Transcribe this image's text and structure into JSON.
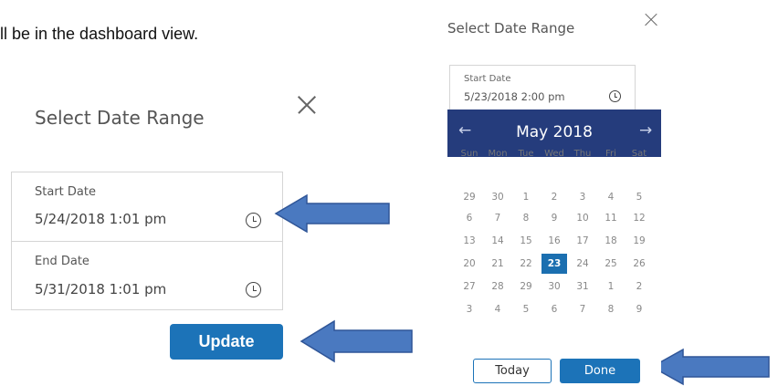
{
  "document": {
    "text_fragment": "ll be in the dashboard view."
  },
  "left_dialog": {
    "title": "Select Date Range",
    "close_icon": "close-icon",
    "start_date": {
      "label": "Start Date",
      "value": "5/24/2018 1:01 pm",
      "icon": "clock-icon"
    },
    "end_date": {
      "label": "End Date",
      "value": "5/31/2018 1:01 pm",
      "icon": "clock-icon"
    },
    "update_label": "Update"
  },
  "right_dialog": {
    "title": "Select Date Range",
    "close_icon": "close-icon",
    "start_date": {
      "label": "Start Date",
      "value": "5/23/2018 2:00 pm",
      "icon": "clock-icon"
    },
    "calendar": {
      "month_label": "May 2018",
      "prev_icon": "←",
      "next_icon": "→",
      "weekdays": [
        "Sun",
        "Mon",
        "Tue",
        "Wed",
        "Thu",
        "Fri",
        "Sat"
      ],
      "weeks": [
        [
          "29",
          "30",
          "1",
          "2",
          "3",
          "4",
          "5"
        ],
        [
          "6",
          "7",
          "8",
          "9",
          "10",
          "11",
          "12"
        ],
        [
          "13",
          "14",
          "15",
          "16",
          "17",
          "18",
          "19"
        ],
        [
          "20",
          "21",
          "22",
          "23",
          "24",
          "25",
          "26"
        ],
        [
          "27",
          "28",
          "29",
          "30",
          "31",
          "1",
          "2"
        ],
        [
          "3",
          "4",
          "5",
          "6",
          "7",
          "8",
          "9"
        ]
      ],
      "selected_day": "23"
    },
    "today_label": "Today",
    "done_label": "Done"
  },
  "colors": {
    "accent_blue": "#1c73b8",
    "calendar_header": "#253c7c",
    "arrow_fill": "#4a79c0",
    "arrow_stroke": "#2f5597"
  }
}
